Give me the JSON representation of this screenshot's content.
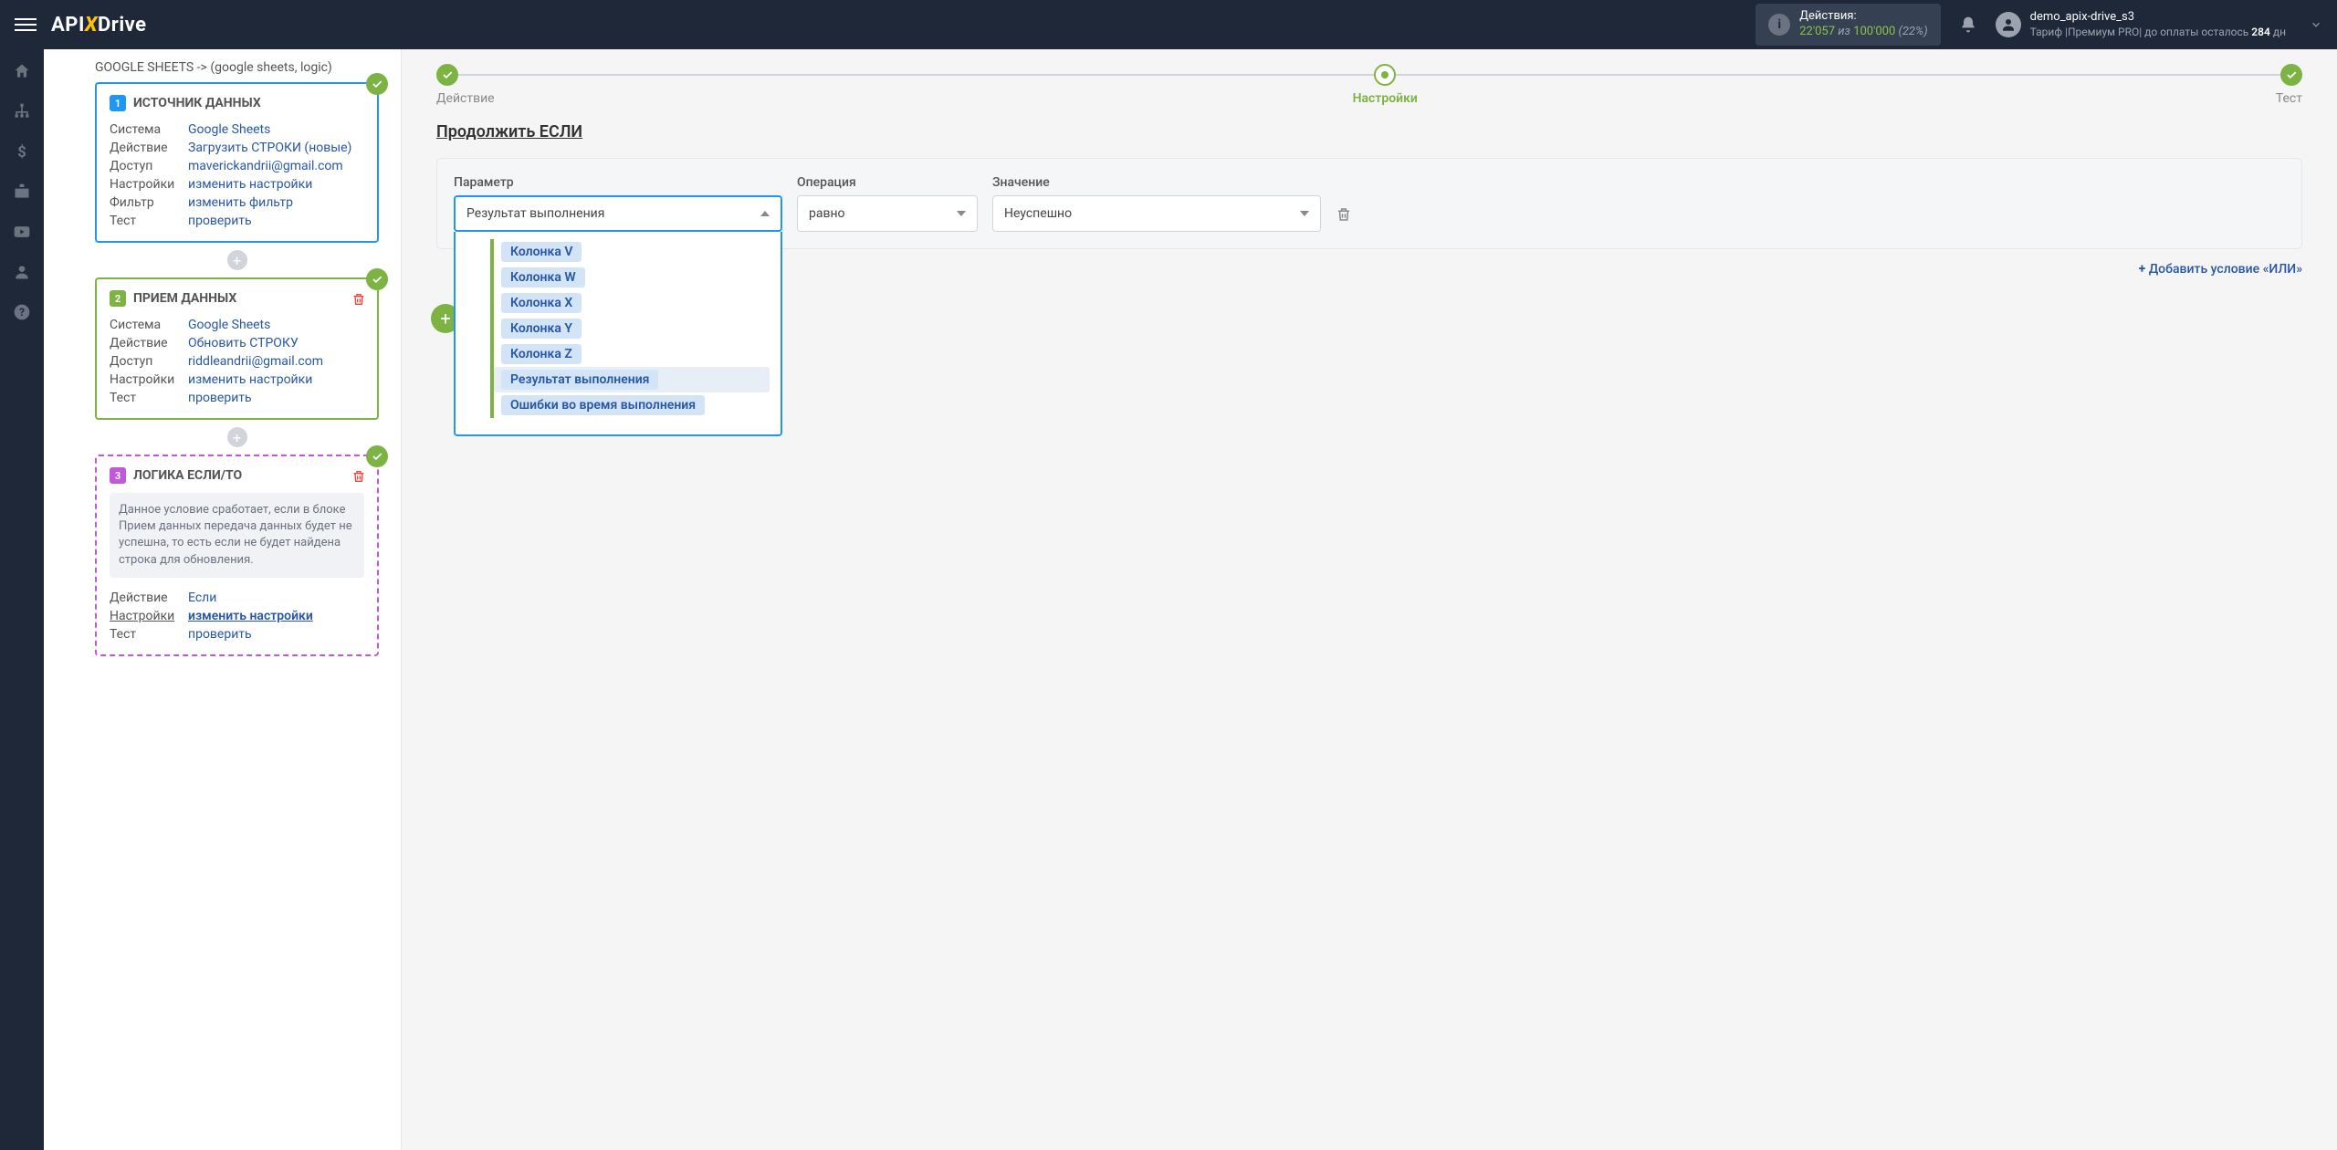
{
  "header": {
    "logo_pre": "API",
    "logo_x": "X",
    "logo_post": "Drive",
    "actions_label": "Действия:",
    "actions_count": "22'057",
    "actions_of": "из",
    "actions_total": "100'000",
    "actions_pct": "(22%)",
    "username": "demo_apix-drive_s3",
    "tariff_pre": "Тариф |Премиум PRO| до оплаты осталось ",
    "tariff_days": "284",
    "tariff_suf": " дн"
  },
  "breadcrumb": "GOOGLE SHEETS -> (google sheets, logic)",
  "card1": {
    "num": "1",
    "title": "ИСТОЧНИК ДАННЫХ",
    "rows": {
      "system_l": "Система",
      "system_v": "Google Sheets",
      "action_l": "Действие",
      "action_v": "Загрузить СТРОКИ (новые)",
      "access_l": "Доступ",
      "access_v": "maverickandrii@gmail.com",
      "settings_l": "Настройки",
      "settings_v": "изменить настройки",
      "filter_l": "Фильтр",
      "filter_v": "изменить фильтр",
      "test_l": "Тест",
      "test_v": "проверить"
    }
  },
  "card2": {
    "num": "2",
    "title": "ПРИЕМ ДАННЫХ",
    "rows": {
      "system_l": "Система",
      "system_v": "Google Sheets",
      "action_l": "Действие",
      "action_v": "Обновить СТРОКУ",
      "access_l": "Доступ",
      "access_v": "riddleandrii@gmail.com",
      "settings_l": "Настройки",
      "settings_v": "изменить настройки",
      "test_l": "Тест",
      "test_v": "проверить"
    }
  },
  "card3": {
    "num": "3",
    "title": "ЛОГИКА ЕСЛИ/ТО",
    "note": "Данное условие сработает, если в блоке Прием данных передача данных будет не успешна, то есть если не будет найдена строка для обновления.",
    "rows": {
      "action_l": "Действие",
      "action_v": "Если",
      "settings_l": "Настройки",
      "settings_v": "изменить настройки",
      "test_l": "Тест",
      "test_v": "проверить"
    }
  },
  "stepper": {
    "s1": "Действие",
    "s2": "Настройки",
    "s3": "Тест"
  },
  "main": {
    "title": "Продолжить ЕСЛИ",
    "param_l": "Параметр",
    "param_v": "Результат выполнения",
    "op_l": "Операция",
    "op_v": "равно",
    "val_l": "Значение",
    "val_v": "Неуспешно",
    "add_or": "Добавить условие «ИЛИ»",
    "options": [
      "Колонка V",
      "Колонка W",
      "Колонка X",
      "Колонка Y",
      "Колонка Z",
      "Результат выполнения",
      "Ошибки во время выполнения"
    ],
    "selected_index": 5
  }
}
